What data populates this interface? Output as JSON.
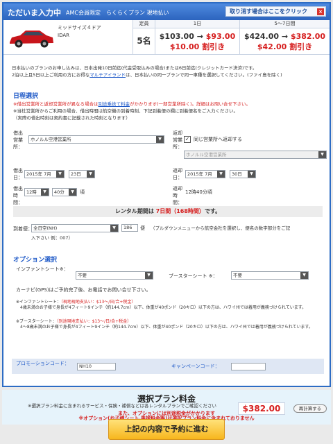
{
  "header": {
    "title": "ただいま入力中",
    "plan": "AMC会員限定　らくらくプラン 現地払い",
    "cancel_label": "取り消す場合はここをクリック",
    "close_icon": "×"
  },
  "car": {
    "name": "ミッドサイズ４ドア",
    "code": "IDAR",
    "capacity_header": "定員",
    "capacity": "5名",
    "day1_header": "1日",
    "day1_price_old": "$103.00",
    "day1_price_new": "$93.00",
    "day1_discount": "$10.00 割引き",
    "week_header": "5～7日間",
    "week_price_old": "$424.00",
    "week_price_new": "$382.00",
    "week_discount": "$42.00 割引き",
    "arrow": "→"
  },
  "notes": {
    "line1": "日本払いのプランのお申し込みは、日本出発10日前迄(代金受取込みの場合)または6日前迄(クレジットカード決済)です。",
    "line2_pre": "2泊以上且5日以上ご利用の方にお得な",
    "line2_link": "マルチアイランド",
    "line2_post": "は、日本払いの同一プランで同一車種を選択してください。(ファイ島を除く)"
  },
  "schedule": {
    "title": "日程選択",
    "warn_pre": "※借出営業所と返却営業所が異なる場合は",
    "warn_link": "別途乗捨て料金",
    "warn_post": "がかかります(一部営業所除く)。詳細はお問い合せ下さい。",
    "info1": "※当社営業所からご利用の場合、借出時間は航空機の到着時刻、下記到着便の欄に到着便名をご入力ください。",
    "info2": "（実際の借出時刻は契約書に記載された時刻となります）",
    "pickup_office_label": "借出営業所：",
    "pickup_office_value": "ホノルル空港営業所",
    "return_office_label": "返却営業所：",
    "same_office_label": "同じ営業所へ返却する",
    "same_office_check": "✓",
    "return_office_value": "ホノルル空港営業所",
    "pickup_date_label": "借出日：",
    "pickup_month": "2015年 7月",
    "pickup_day": "23日",
    "return_date_label": "返却日：",
    "return_month": "2015年 7月",
    "return_day": "30日",
    "pickup_time_label": "借出時間：",
    "pickup_hour": "12時",
    "pickup_min": "40分",
    "pickup_time_suffix": "頃",
    "return_time_label": "返却時間：",
    "return_time_value": "12時40分頃",
    "period_label": "レンタル期間は",
    "period_value": "7日間（168時間）",
    "period_suffix": "です。",
    "flight_label": "到着便：",
    "flight_airline": "全日空(NH)",
    "flight_number": "186",
    "flight_suffix": "便",
    "flight_help": "（プルダウンメニューから航空会社を選択し、便名の数字部分をご記",
    "flight_example": "入下さい 例：007）",
    "arrow_glyph": "▼"
  },
  "options": {
    "title": "オプション選択",
    "infant_label": "インファントシート※：",
    "infant_value": "不要",
    "booster_label": "ブースターシート ※：",
    "booster_value": "不要",
    "gps_note": "カーナビ(GPS)はご予約完了後、お電話でお問い合せ下さい。",
    "infant_note_head": "※インファントシート：",
    "infant_note_red": "（現地現地支払い：$13～/日/合+税金）",
    "infant_note_body": "4歳未満のお子様で身長が4フィート9インチ（約144.7cm）以下、体重が40ポンド（20キロ）以下の方は、ハワイ州では着用が義務づけられています。",
    "booster_note_head": "※ブースターシート：",
    "booster_note_red": "（別途現地支払い：$13～/日/合+税金）",
    "booster_note_body": "4～8歳未満のお子様で身長が4フィート9インチ（約144.7cm）以下、体重が40ポンド（20キロ）以下の方は、ハワイ州では着用が義務づけられています。"
  },
  "promo": {
    "promo_label": "プロモーションコード：",
    "promo_value": "NH10",
    "campaign_label": "キャンペーンコード：",
    "campaign_value": ""
  },
  "summary": {
    "title": "選択プラン料金",
    "note": "※選択プラン料金に含まれるサービス・保険・補償などは各レンタルプランでご確認ください",
    "price": "$382.00",
    "recalc_label": "再計算する",
    "warn1": "※オプション(お子様シート,乗捨料金等)は選択プラン料金に含まれておりません",
    "warn2": "また、オプションには別途税金がかかります"
  },
  "submit": {
    "label": "上記の内容で予約に進む"
  },
  "colors": {
    "accent": "#2d6cc4",
    "price_red": "#d61f1f",
    "link_blue": "#1d58c7",
    "button_yellow": "#f7b61d"
  }
}
